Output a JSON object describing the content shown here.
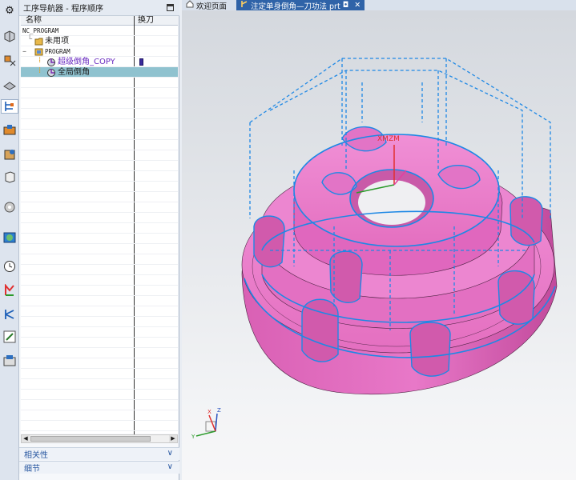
{
  "navigator": {
    "title": "工序导航器 - 程序顺序",
    "columns": {
      "name": "名称",
      "tool_change": "换刀"
    },
    "rows": [
      {
        "label": "NC_PROGRAM",
        "indent": 0,
        "kind": "root"
      },
      {
        "label": "未用项",
        "indent": 1,
        "kind": "folder"
      },
      {
        "label": "PROGRAM",
        "indent": 1,
        "kind": "program"
      },
      {
        "label": "超级倒角_COPY",
        "indent": 2,
        "kind": "operation"
      },
      {
        "label": "全局倒角",
        "indent": 2,
        "kind": "operation"
      }
    ],
    "sections": {
      "relations": "相关性",
      "details": "细节"
    }
  },
  "tabs": [
    {
      "label": "欢迎页面",
      "icon": "home-icon"
    },
    {
      "label": "注定单身倒角—刀功法 prt",
      "icon": "part-icon",
      "active": true,
      "modified_marker": "◘"
    }
  ],
  "viewport": {
    "wcs_labels": {
      "x": "XM",
      "z": "ZM"
    },
    "triad_labels": {
      "x": "X",
      "y": "Y",
      "z": "Z"
    }
  },
  "colors": {
    "part": "#e472c1",
    "toolpath": "#1e88e5",
    "selection": "#8fc2cf",
    "active_tab": "#2f63a8"
  },
  "resource_bar_icons": [
    "gear-icon",
    "assembly-icon",
    "constraint-icon",
    "part-icon",
    "operation-navigator-icon",
    "machine-tool-icon",
    "feature-icon",
    "reuse-library-icon",
    "history-icon",
    "web-browser-icon",
    "clock-icon",
    "process-icon",
    "roles-icon",
    "system-materials-icon",
    "cam-icon"
  ]
}
